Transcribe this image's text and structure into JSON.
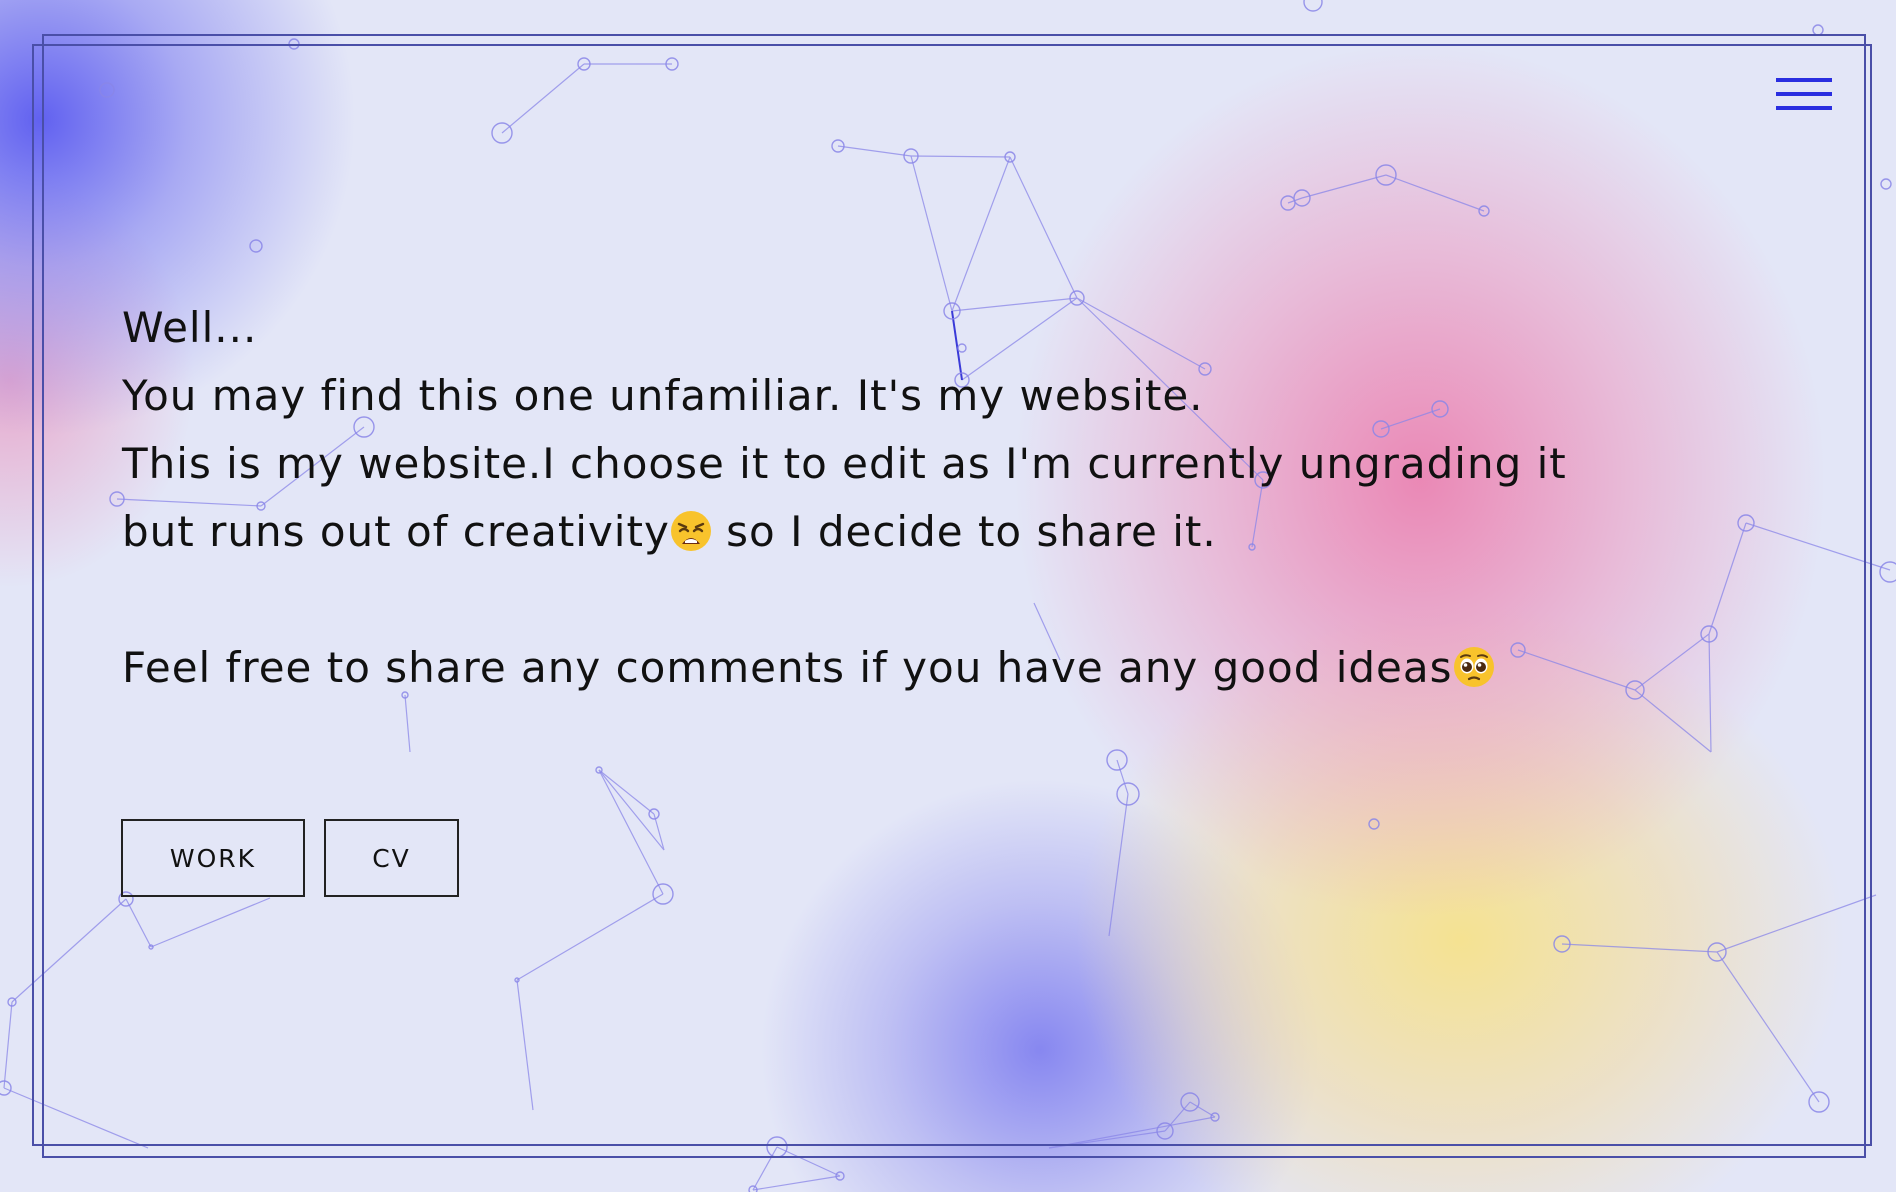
{
  "content": {
    "greeting": "Well...",
    "line_1": "You may find this one unfamiliar. It's my website.",
    "line_2": "This is my website.I choose it to edit as I'm currently ungrading it",
    "line_3_before_emoji": "but runs out of creativity",
    "line_3_after_emoji": " so I decide to share it.",
    "line_4": "Feel free to share any comments if you have any good ideas",
    "emoji_1": "weary-face-emoji",
    "emoji_2": "pleading-face-emoji"
  },
  "buttons": {
    "work_label": "WORK",
    "cv_label": "CV"
  },
  "header": {
    "menu_icon": "hamburger-menu-icon"
  },
  "colors": {
    "accent": "#2a2ee0",
    "frame": "#4a4fa8",
    "background": "#e3e6f7",
    "blob_blue": "#5a5af0",
    "blob_pink": "#ec78aa",
    "blob_yellow": "#f6e28c"
  }
}
